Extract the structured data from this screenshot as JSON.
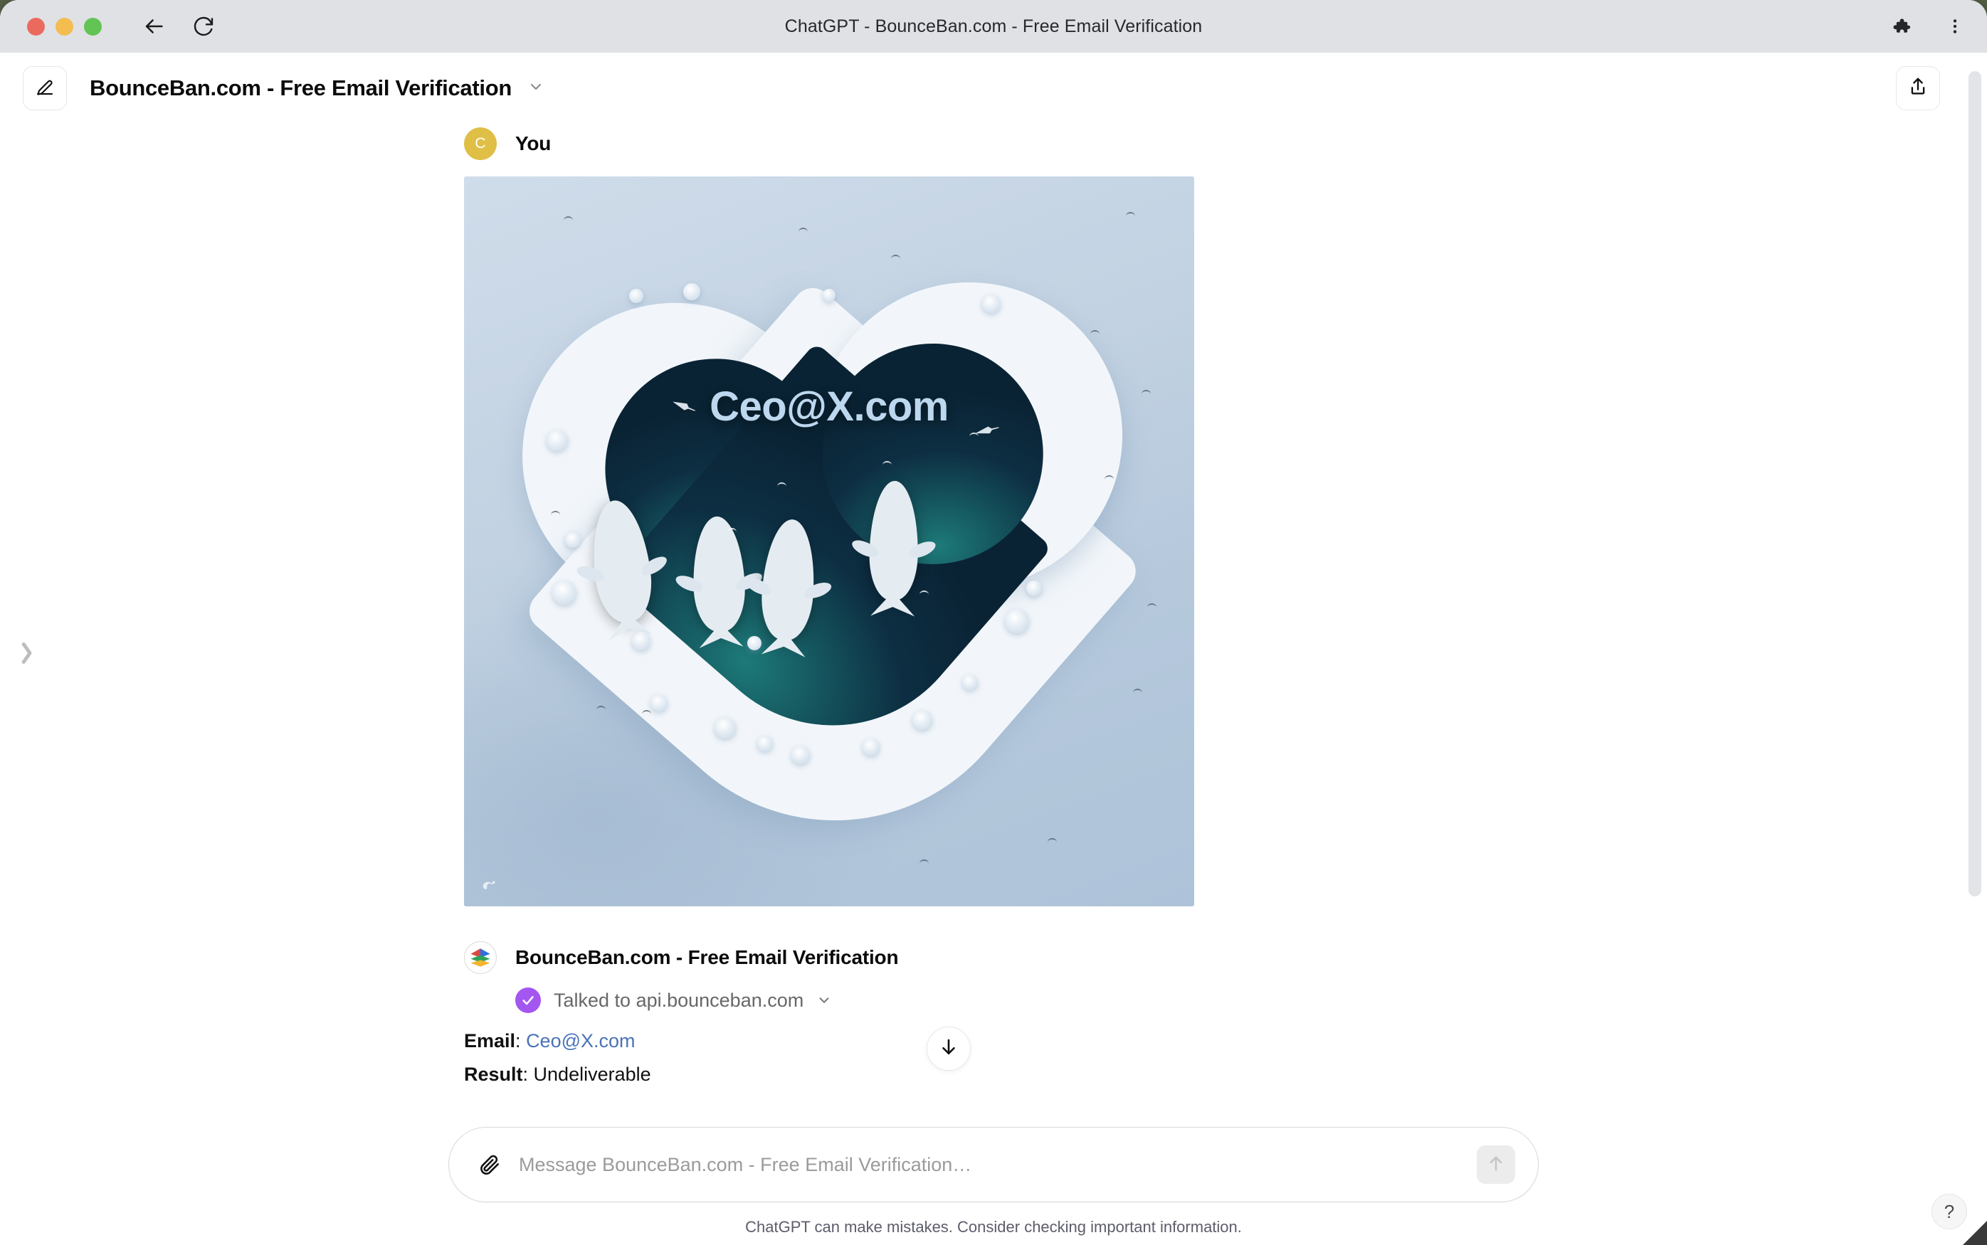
{
  "window": {
    "title": "ChatGPT - BounceBan.com - Free Email Verification",
    "traffic_lights": [
      "close",
      "minimize",
      "maximize"
    ],
    "back_icon": "back-arrow-icon",
    "reload_icon": "reload-icon",
    "extensions_icon": "puzzle-piece-icon",
    "menu_icon": "three-dot-menu-icon",
    "colors": {
      "titlebar_bg": "#dfe1e5",
      "close": "#eb6a5e",
      "minimize": "#f3bd4f",
      "maximize": "#61c454"
    }
  },
  "header": {
    "new_chat_icon": "compose-pencil-icon",
    "chat_title": "BounceBan.com - Free Email Verification",
    "title_caret_icon": "chevron-down-icon",
    "share_icon": "share-upload-icon"
  },
  "conversation": {
    "user_message": {
      "avatar_letter": "C",
      "avatar_color": "#e0bf47",
      "sender": "You",
      "image": {
        "alt": "Aerial view of a heart-shaped snow island with dark teal lagoon, four white whales and birds",
        "overlay_text": "Ceo@X.com",
        "overlay_text_color": "#bcd7ee",
        "watermark": "image-generator-watermark"
      }
    },
    "assistant_message": {
      "avatar_icon": "bounceban-layers-logo",
      "sender": "BounceBan.com - Free Email Verification",
      "tool_call": {
        "status_icon": "purple-check-icon",
        "status_color": "#a456f0",
        "text": "Talked to api.bounceban.com",
        "caret_icon": "chevron-down-icon"
      },
      "fields": [
        {
          "label": "Email",
          "value": "Ceo@X.com",
          "is_link": true,
          "link_color": "#4a73b8"
        },
        {
          "label": "Result",
          "value": "Undeliverable",
          "is_link": false
        }
      ]
    },
    "scroll_to_bottom_icon": "arrow-down-icon"
  },
  "composer": {
    "attach_icon": "paperclip-icon",
    "input_value": "",
    "placeholder": "Message BounceBan.com - Free Email Verification…",
    "send_icon": "arrow-up-icon",
    "send_enabled": false
  },
  "footer": {
    "disclaimer": "ChatGPT can make mistakes. Consider checking important information."
  },
  "chrome": {
    "sidebar_handle_icon": "chevron-right-icon",
    "help_label": "?",
    "scrollbar": "vertical-scrollbar"
  }
}
